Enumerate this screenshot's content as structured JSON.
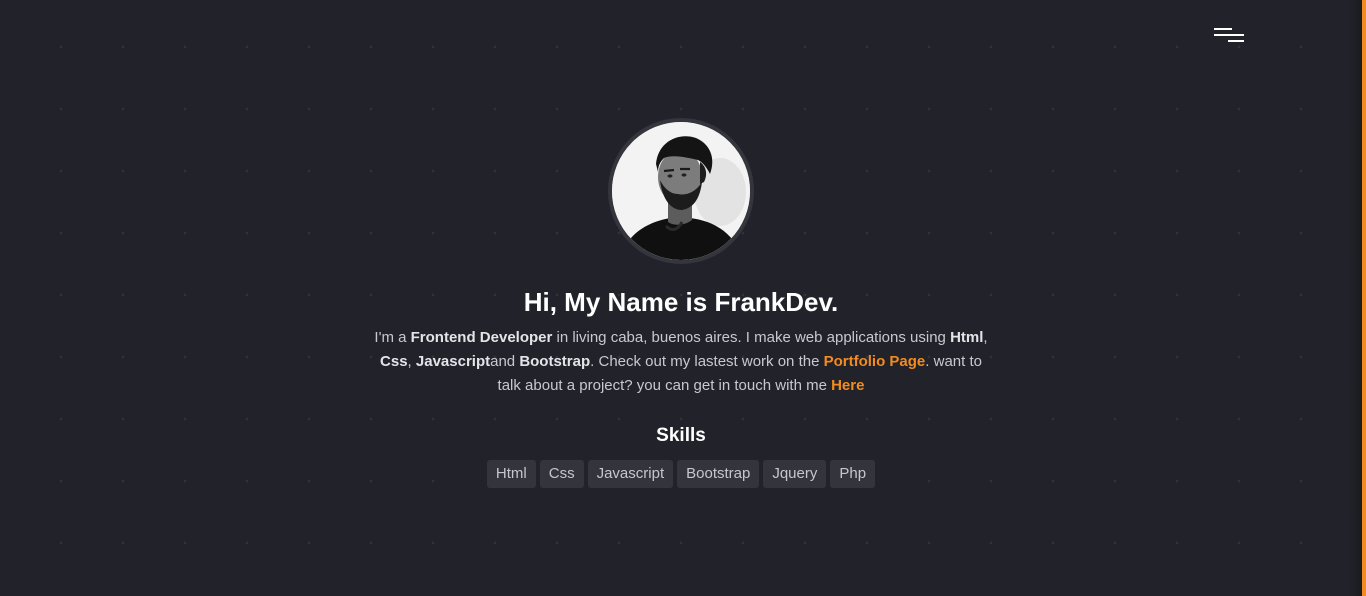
{
  "colors": {
    "background": "#22232a",
    "accent": "#f28b20",
    "chip_background": "#34353c",
    "heading": "#ffffff"
  },
  "header": {
    "menu_icon": "menu-icon"
  },
  "hero": {
    "avatar_icon": "profile-photo",
    "title": "Hi, My Name is FrankDev.",
    "intro": {
      "p1": "I'm a ",
      "role": "Frontend Developer",
      "p2": " in living caba, buenos aires. I make web applications using ",
      "tech1": "Html",
      "sep1": ", ",
      "tech2": "Css",
      "sep2": ", ",
      "tech3": "Javascript",
      "p3": "and ",
      "tech4": "Bootstrap",
      "p4": ". Check out my lastest work on the ",
      "portfolio_link": "Portfolio Page",
      "p5": ". want to talk about a project? you can get in touch with me ",
      "here_link": "Here"
    },
    "skills_title": "Skills",
    "skills": [
      "Html",
      "Css",
      "Javascript",
      "Bootstrap",
      "Jquery",
      "Php"
    ]
  }
}
